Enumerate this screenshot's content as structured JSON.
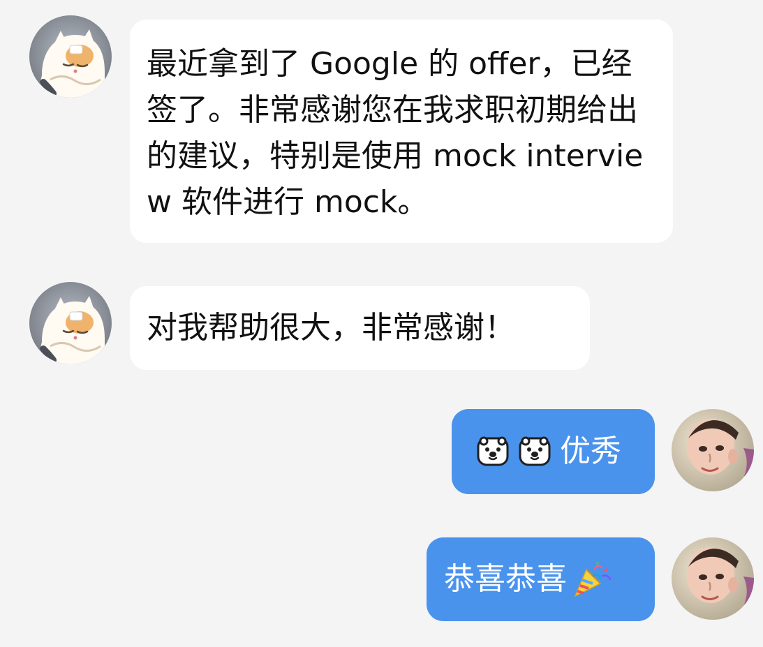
{
  "messages": [
    {
      "side": "incoming",
      "sender_avatar": "cat-avatar",
      "text": "最近拿到了 Google 的 offer，已经签了。非常感谢您在我求职初期给出的建议，特别是使用 mock interview 软件进行 mock。"
    },
    {
      "side": "incoming",
      "sender_avatar": "cat-avatar",
      "text": "对我帮助很大，非常感谢！"
    },
    {
      "side": "outgoing",
      "sender_avatar": "child-avatar",
      "emojis": [
        "polar-bear-emoji",
        "polar-bear-emoji"
      ],
      "text": "优秀"
    },
    {
      "side": "outgoing",
      "sender_avatar": "child-avatar",
      "text": "恭喜恭喜",
      "emojis_after": [
        "party-popper-emoji"
      ]
    }
  ],
  "colors": {
    "background": "#f4f4f4",
    "incoming_bubble": "#ffffff",
    "outgoing_bubble": "#4a93ed",
    "incoming_text": "#111111",
    "outgoing_text": "#ffffff"
  }
}
